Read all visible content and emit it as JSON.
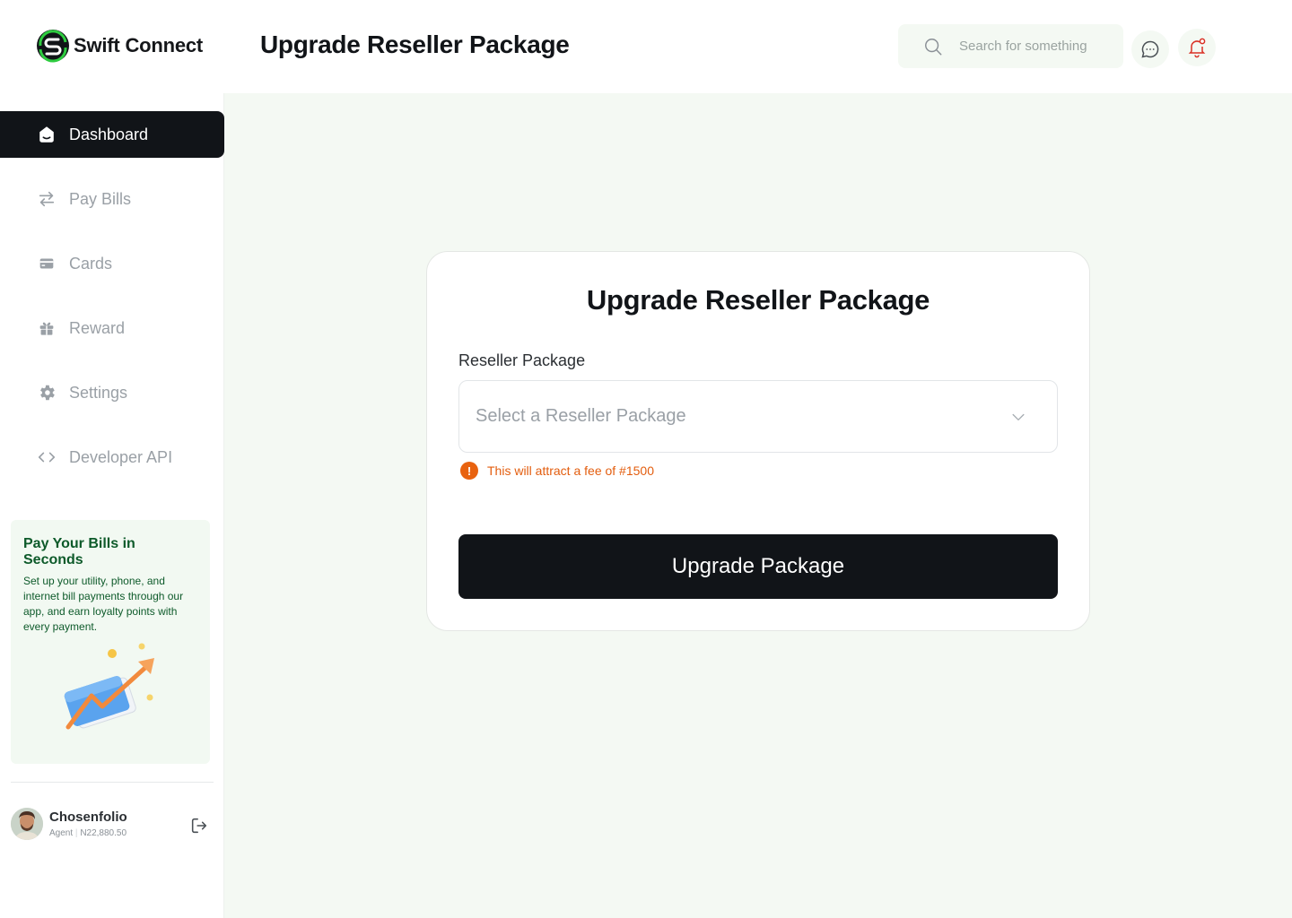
{
  "app": {
    "name": "Swift Connect"
  },
  "header": {
    "title": "Upgrade Reseller Package",
    "search_placeholder": "Search for something"
  },
  "sidebar": {
    "items": [
      {
        "label": "Dashboard",
        "icon": "home-icon",
        "active": true
      },
      {
        "label": "Pay Bills",
        "icon": "transfer-arrows-icon",
        "active": false
      },
      {
        "label": "Cards",
        "icon": "card-icon",
        "active": false
      },
      {
        "label": "Reward",
        "icon": "gift-icon",
        "active": false
      },
      {
        "label": "Settings",
        "icon": "gear-icon",
        "active": false
      },
      {
        "label": "Developer API",
        "icon": "code-icon",
        "active": false
      }
    ],
    "promo": {
      "title": "Pay Your Bills in Seconds",
      "text": "Set up your utility, phone, and internet bill payments through our app, and earn loyalty points with every payment."
    },
    "user": {
      "name": "Chosenfolio",
      "role": "Agent",
      "balance": "N22,880.50"
    }
  },
  "main": {
    "card": {
      "title": "Upgrade Reseller Package",
      "field_label": "Reseller Package",
      "select_placeholder": "Select a Reseller Package",
      "fee_note": "This will attract a fee of #1500",
      "button_label": "Upgrade Package"
    }
  },
  "colors": {
    "primary": "#111418",
    "page_bg": "#f4f9f3",
    "brand_green": "#0d5a2a",
    "warning": "#e35d0e",
    "notification": "#d93025"
  }
}
